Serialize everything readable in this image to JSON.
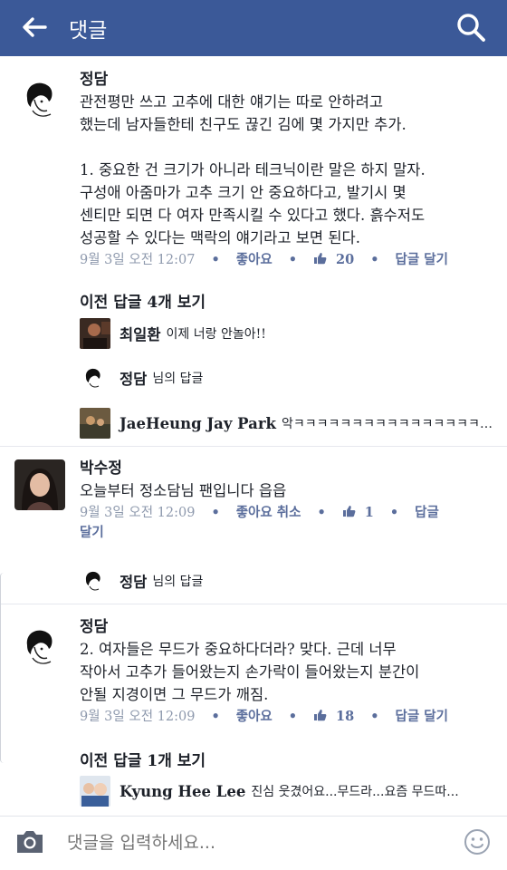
{
  "header": {
    "title": "댓글",
    "back_icon": "back-arrow-icon",
    "search_icon": "search-icon",
    "color": "#3b5998"
  },
  "comments": [
    {
      "author": "정담",
      "text": "관전평만 쓰고 고추에 대한 얘기는 따로 안하려고\n했는데 남자들한테 친구도 끊긴 김에 몇 가지만 추가.\n\n1. 중요한 건 크기가 아니라 테크닉이란 말은 하지 말자.\n구성애 아줌마가 고추 크기 안 중요하다고, 발기시 몇\n센티만 되면 다 여자 만족시킬 수 있다고 했다. 흙수저도\n성공할 수 있다는 맥락의 얘기라고 보면 된다.",
      "time": "9월 3일 오전 12:07",
      "like": "좋아요",
      "likes": "20",
      "reply": "답글 달기",
      "prev_replies": "이전 답글 4개 보기",
      "replies": [
        {
          "name": "최일환",
          "text": "이제 너랑 안놀아!!"
        }
      ],
      "reply_to": {
        "name": "정담",
        "suffix": "님의 답글"
      },
      "reply2": {
        "name": "JaeHeung Jay Park",
        "text": "악ㅋㅋㅋㅋㅋㅋㅋㅋㅋㅋㅋㅋㅋㅋㅋㅋㅋㅋㅋㅋㅋㅋ..."
      }
    },
    {
      "author": "박수정",
      "text": "오늘부터 정소담님 팬입니다 읍읍",
      "time": "9월 3일 오전 12:09",
      "like": "좋아요 취소",
      "likes": "1",
      "reply_part1": "답글",
      "reply_part2": "달기",
      "reply_to": {
        "name": "정담",
        "suffix": "님의 답글"
      }
    },
    {
      "author": "정담",
      "text": "2. 여자들은 무드가 중요하다더라? 맞다. 근데 너무\n작아서 고추가 들어왔는지 손가락이 들어왔는지 분간이\n안될 지경이면 그 무드가 깨짐.",
      "time": "9월 3일 오전 12:09",
      "like": "좋아요",
      "likes": "18",
      "reply": "답글 달기",
      "prev_replies": "이전 답글 1개 보기",
      "replies": [
        {
          "name": "Kyung Hee Lee",
          "text": "진심 웃겼어요...무드라...요즘 무드따..."
        }
      ]
    }
  ],
  "composer": {
    "placeholder": "댓글을 입력하세요...",
    "camera_icon": "camera-icon",
    "emoji_icon": "emoji-icon"
  }
}
